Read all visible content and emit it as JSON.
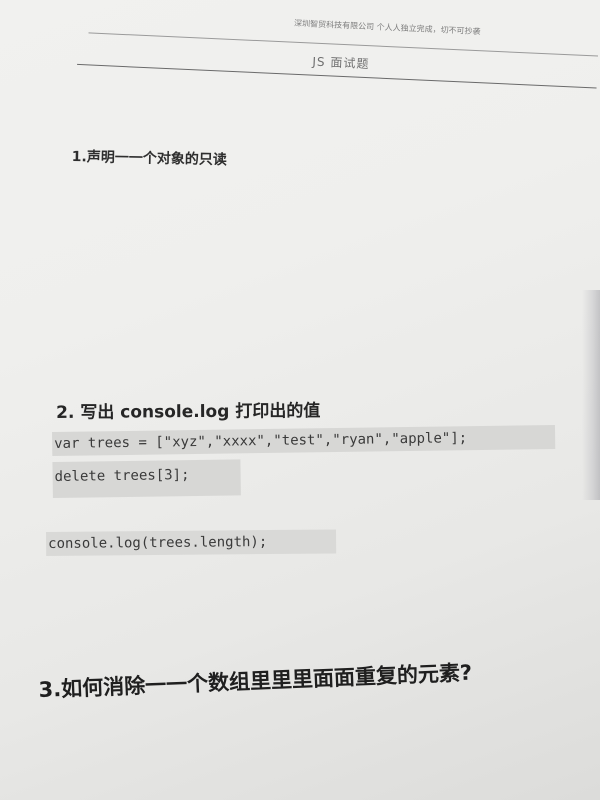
{
  "header": {
    "company": "深圳智贸科技有限公司 个人人独立完成，切不可抄袭",
    "title": "JS 面试题"
  },
  "questions": {
    "q1": "1.声明一一个对象的只读",
    "q2": "2. 写出 console.log 打印出的值",
    "q3": "3.如何消除一一个数组里里里面面重复的元素?"
  },
  "code": {
    "line1": "var trees = [\"xyz\",\"xxxx\",\"test\",\"ryan\",\"apple\"];",
    "line2": "delete trees[3];",
    "line3": "console.log(trees.length);"
  },
  "colors": {
    "paper": "#efefed",
    "code_highlight": "#d7d7d5",
    "text": "#262626"
  }
}
